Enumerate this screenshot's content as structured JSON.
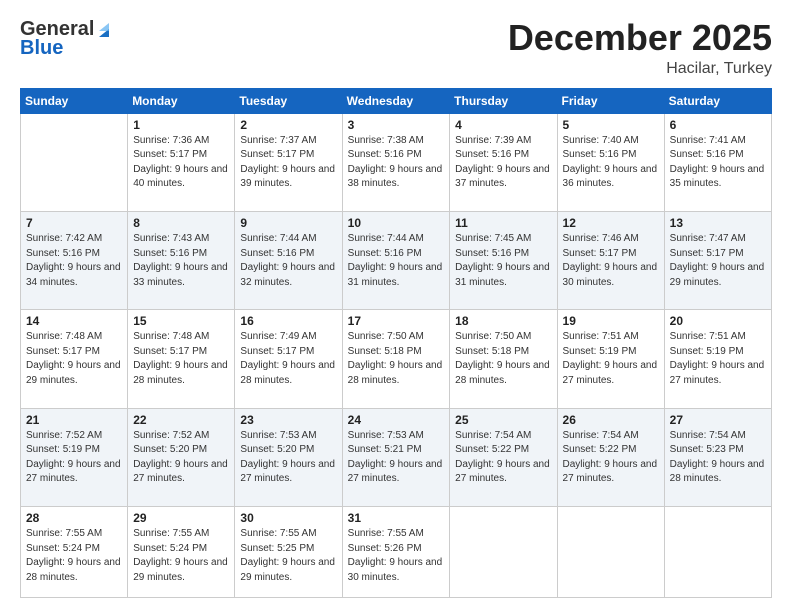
{
  "header": {
    "logo_general": "General",
    "logo_blue": "Blue",
    "month": "December 2025",
    "location": "Hacilar, Turkey"
  },
  "days_of_week": [
    "Sunday",
    "Monday",
    "Tuesday",
    "Wednesday",
    "Thursday",
    "Friday",
    "Saturday"
  ],
  "weeks": [
    [
      {
        "day": "",
        "sunrise": "",
        "sunset": "",
        "daylight": ""
      },
      {
        "day": "1",
        "sunrise": "Sunrise: 7:36 AM",
        "sunset": "Sunset: 5:17 PM",
        "daylight": "Daylight: 9 hours and 40 minutes."
      },
      {
        "day": "2",
        "sunrise": "Sunrise: 7:37 AM",
        "sunset": "Sunset: 5:17 PM",
        "daylight": "Daylight: 9 hours and 39 minutes."
      },
      {
        "day": "3",
        "sunrise": "Sunrise: 7:38 AM",
        "sunset": "Sunset: 5:16 PM",
        "daylight": "Daylight: 9 hours and 38 minutes."
      },
      {
        "day": "4",
        "sunrise": "Sunrise: 7:39 AM",
        "sunset": "Sunset: 5:16 PM",
        "daylight": "Daylight: 9 hours and 37 minutes."
      },
      {
        "day": "5",
        "sunrise": "Sunrise: 7:40 AM",
        "sunset": "Sunset: 5:16 PM",
        "daylight": "Daylight: 9 hours and 36 minutes."
      },
      {
        "day": "6",
        "sunrise": "Sunrise: 7:41 AM",
        "sunset": "Sunset: 5:16 PM",
        "daylight": "Daylight: 9 hours and 35 minutes."
      }
    ],
    [
      {
        "day": "7",
        "sunrise": "Sunrise: 7:42 AM",
        "sunset": "Sunset: 5:16 PM",
        "daylight": "Daylight: 9 hours and 34 minutes."
      },
      {
        "day": "8",
        "sunrise": "Sunrise: 7:43 AM",
        "sunset": "Sunset: 5:16 PM",
        "daylight": "Daylight: 9 hours and 33 minutes."
      },
      {
        "day": "9",
        "sunrise": "Sunrise: 7:44 AM",
        "sunset": "Sunset: 5:16 PM",
        "daylight": "Daylight: 9 hours and 32 minutes."
      },
      {
        "day": "10",
        "sunrise": "Sunrise: 7:44 AM",
        "sunset": "Sunset: 5:16 PM",
        "daylight": "Daylight: 9 hours and 31 minutes."
      },
      {
        "day": "11",
        "sunrise": "Sunrise: 7:45 AM",
        "sunset": "Sunset: 5:16 PM",
        "daylight": "Daylight: 9 hours and 31 minutes."
      },
      {
        "day": "12",
        "sunrise": "Sunrise: 7:46 AM",
        "sunset": "Sunset: 5:17 PM",
        "daylight": "Daylight: 9 hours and 30 minutes."
      },
      {
        "day": "13",
        "sunrise": "Sunrise: 7:47 AM",
        "sunset": "Sunset: 5:17 PM",
        "daylight": "Daylight: 9 hours and 29 minutes."
      }
    ],
    [
      {
        "day": "14",
        "sunrise": "Sunrise: 7:48 AM",
        "sunset": "Sunset: 5:17 PM",
        "daylight": "Daylight: 9 hours and 29 minutes."
      },
      {
        "day": "15",
        "sunrise": "Sunrise: 7:48 AM",
        "sunset": "Sunset: 5:17 PM",
        "daylight": "Daylight: 9 hours and 28 minutes."
      },
      {
        "day": "16",
        "sunrise": "Sunrise: 7:49 AM",
        "sunset": "Sunset: 5:17 PM",
        "daylight": "Daylight: 9 hours and 28 minutes."
      },
      {
        "day": "17",
        "sunrise": "Sunrise: 7:50 AM",
        "sunset": "Sunset: 5:18 PM",
        "daylight": "Daylight: 9 hours and 28 minutes."
      },
      {
        "day": "18",
        "sunrise": "Sunrise: 7:50 AM",
        "sunset": "Sunset: 5:18 PM",
        "daylight": "Daylight: 9 hours and 28 minutes."
      },
      {
        "day": "19",
        "sunrise": "Sunrise: 7:51 AM",
        "sunset": "Sunset: 5:19 PM",
        "daylight": "Daylight: 9 hours and 27 minutes."
      },
      {
        "day": "20",
        "sunrise": "Sunrise: 7:51 AM",
        "sunset": "Sunset: 5:19 PM",
        "daylight": "Daylight: 9 hours and 27 minutes."
      }
    ],
    [
      {
        "day": "21",
        "sunrise": "Sunrise: 7:52 AM",
        "sunset": "Sunset: 5:19 PM",
        "daylight": "Daylight: 9 hours and 27 minutes."
      },
      {
        "day": "22",
        "sunrise": "Sunrise: 7:52 AM",
        "sunset": "Sunset: 5:20 PM",
        "daylight": "Daylight: 9 hours and 27 minutes."
      },
      {
        "day": "23",
        "sunrise": "Sunrise: 7:53 AM",
        "sunset": "Sunset: 5:20 PM",
        "daylight": "Daylight: 9 hours and 27 minutes."
      },
      {
        "day": "24",
        "sunrise": "Sunrise: 7:53 AM",
        "sunset": "Sunset: 5:21 PM",
        "daylight": "Daylight: 9 hours and 27 minutes."
      },
      {
        "day": "25",
        "sunrise": "Sunrise: 7:54 AM",
        "sunset": "Sunset: 5:22 PM",
        "daylight": "Daylight: 9 hours and 27 minutes."
      },
      {
        "day": "26",
        "sunrise": "Sunrise: 7:54 AM",
        "sunset": "Sunset: 5:22 PM",
        "daylight": "Daylight: 9 hours and 27 minutes."
      },
      {
        "day": "27",
        "sunrise": "Sunrise: 7:54 AM",
        "sunset": "Sunset: 5:23 PM",
        "daylight": "Daylight: 9 hours and 28 minutes."
      }
    ],
    [
      {
        "day": "28",
        "sunrise": "Sunrise: 7:55 AM",
        "sunset": "Sunset: 5:24 PM",
        "daylight": "Daylight: 9 hours and 28 minutes."
      },
      {
        "day": "29",
        "sunrise": "Sunrise: 7:55 AM",
        "sunset": "Sunset: 5:24 PM",
        "daylight": "Daylight: 9 hours and 29 minutes."
      },
      {
        "day": "30",
        "sunrise": "Sunrise: 7:55 AM",
        "sunset": "Sunset: 5:25 PM",
        "daylight": "Daylight: 9 hours and 29 minutes."
      },
      {
        "day": "31",
        "sunrise": "Sunrise: 7:55 AM",
        "sunset": "Sunset: 5:26 PM",
        "daylight": "Daylight: 9 hours and 30 minutes."
      },
      {
        "day": "",
        "sunrise": "",
        "sunset": "",
        "daylight": ""
      },
      {
        "day": "",
        "sunrise": "",
        "sunset": "",
        "daylight": ""
      },
      {
        "day": "",
        "sunrise": "",
        "sunset": "",
        "daylight": ""
      }
    ]
  ]
}
